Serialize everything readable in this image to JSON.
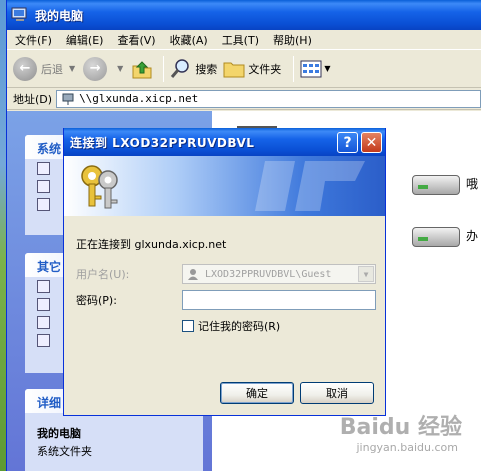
{
  "window": {
    "title": "我的电脑"
  },
  "menu": [
    "文件(F)",
    "编辑(E)",
    "查看(V)",
    "收藏(A)",
    "工具(T)",
    "帮助(H)"
  ],
  "toolbar": {
    "back_label": "后退",
    "search_label": "搜索",
    "folders_label": "文件夹"
  },
  "address": {
    "label": "地址(D)",
    "value": "\\\\glxunda.xicp.net"
  },
  "taskpane": {
    "panel1_title": "系统",
    "panel2_title": "其它",
    "details_title": "详细",
    "details_name": "我的电脑",
    "details_type": "系统文件夹"
  },
  "drives": [
    {
      "label": "哦"
    },
    {
      "label": "办"
    }
  ],
  "dialog": {
    "title": "连接到 LXOD32PPRUVDBVL",
    "help_label": "?",
    "close_label": "✕",
    "connecting_text": "正在连接到 glxunda.xicp.net",
    "username_label": "用户名(U):",
    "username_value": "LXOD32PPRUVDBVL\\Guest",
    "password_label": "密码(P):",
    "password_value": "",
    "remember_label": "记住我的密码(R)",
    "remember_checked": false,
    "ok_label": "确定",
    "cancel_label": "取消"
  },
  "watermark": {
    "logo": "Baidu 经验",
    "url": "jingyan.baidu.com"
  }
}
